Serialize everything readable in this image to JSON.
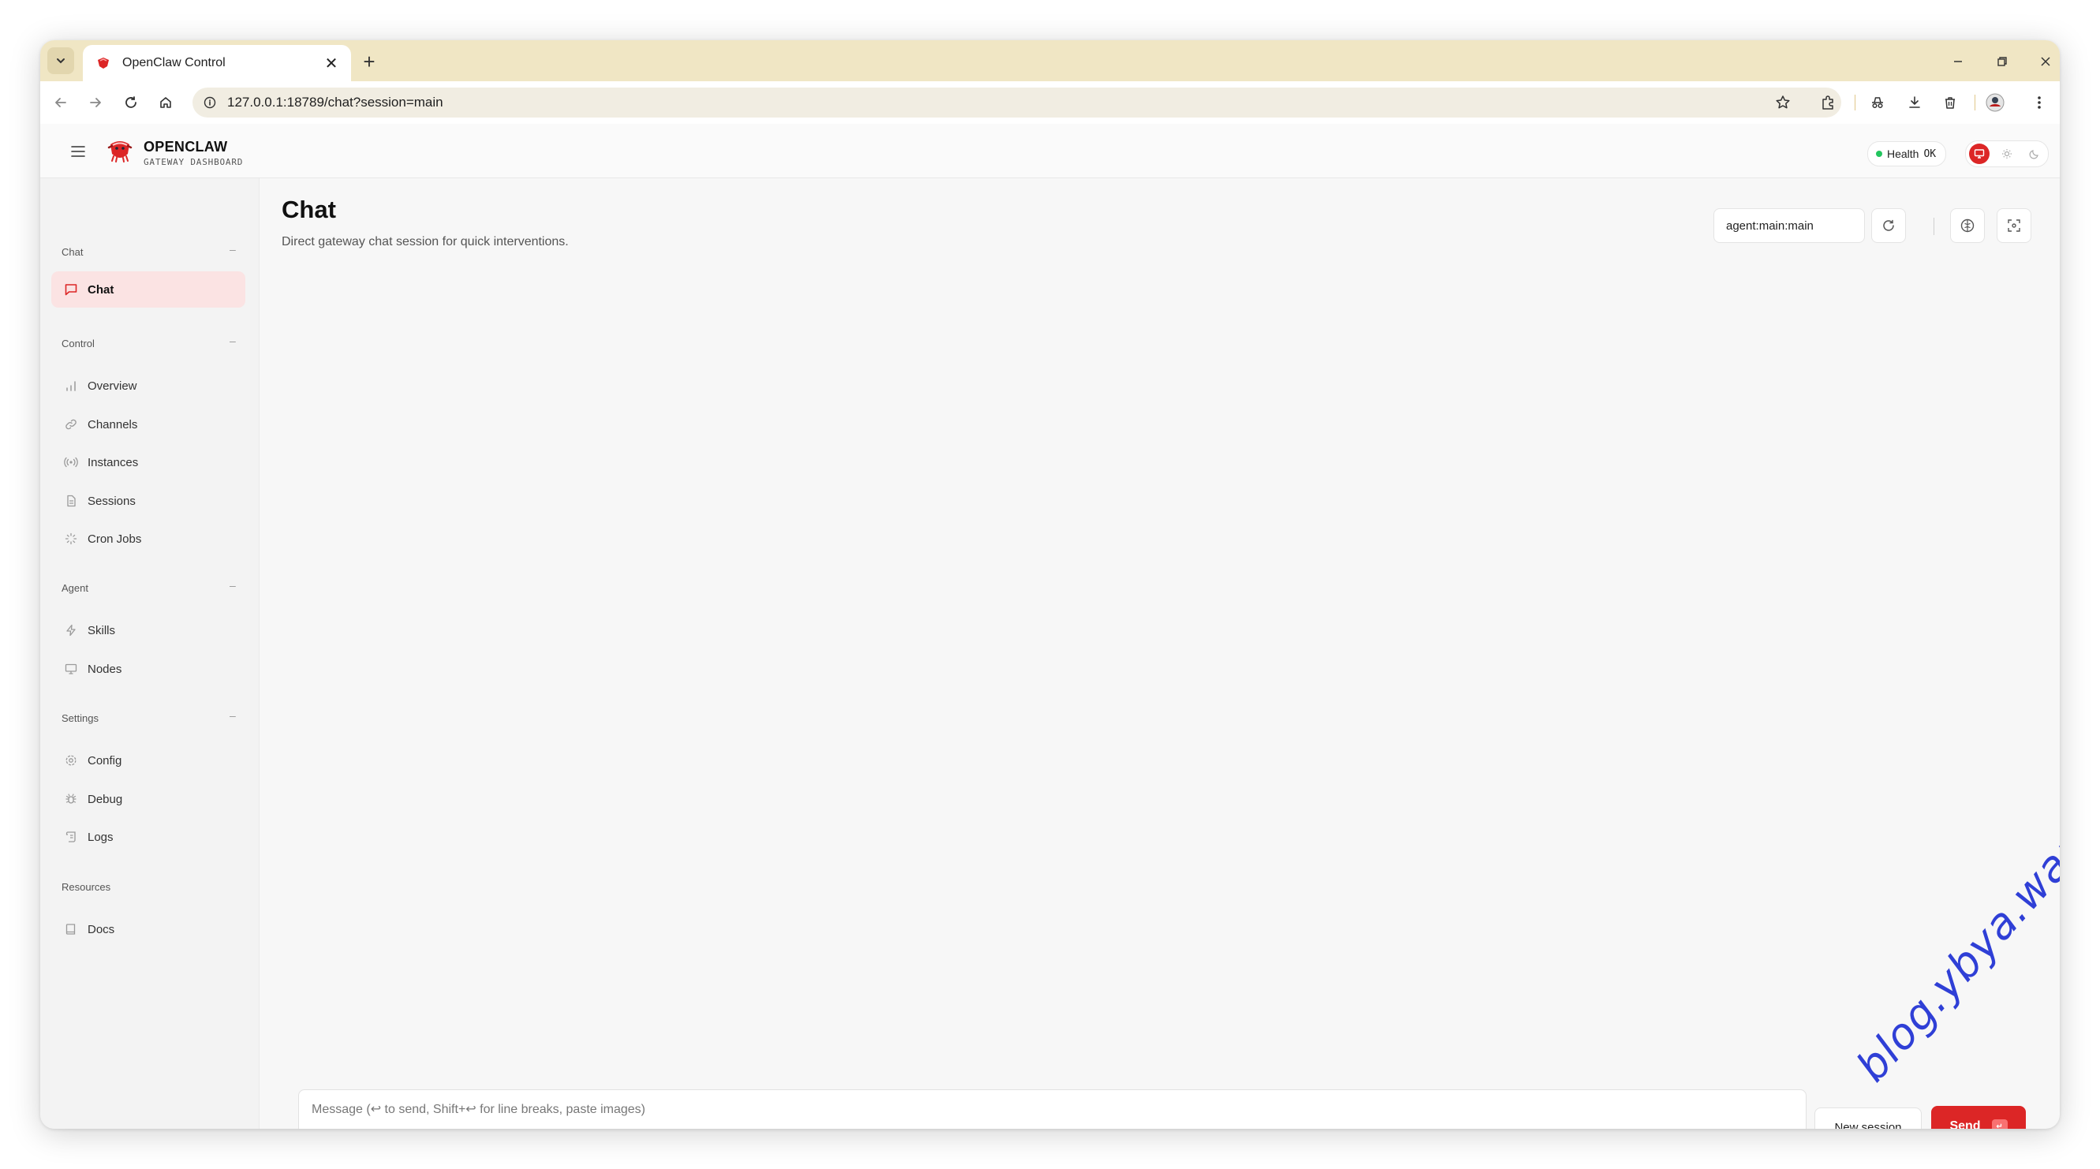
{
  "browser": {
    "tab_title": "OpenClaw Control",
    "url": "127.0.0.1:18789/chat?session=main"
  },
  "header": {
    "brand_name": "OPENCLAW",
    "brand_sub": "GATEWAY DASHBOARD",
    "health_label": "Health",
    "health_status": "OK"
  },
  "sidebar": {
    "sections": [
      {
        "label": "Chat",
        "items": [
          {
            "label": "Chat",
            "icon": "message-square-icon",
            "active": true
          }
        ]
      },
      {
        "label": "Control",
        "items": [
          {
            "label": "Overview",
            "icon": "bar-chart-icon"
          },
          {
            "label": "Channels",
            "icon": "link-icon"
          },
          {
            "label": "Instances",
            "icon": "radio-icon"
          },
          {
            "label": "Sessions",
            "icon": "file-text-icon"
          },
          {
            "label": "Cron Jobs",
            "icon": "loader-icon"
          }
        ]
      },
      {
        "label": "Agent",
        "items": [
          {
            "label": "Skills",
            "icon": "zap-icon"
          },
          {
            "label": "Nodes",
            "icon": "monitor-icon"
          }
        ]
      },
      {
        "label": "Settings",
        "items": [
          {
            "label": "Config",
            "icon": "settings-icon"
          },
          {
            "label": "Debug",
            "icon": "bug-icon"
          },
          {
            "label": "Logs",
            "icon": "scroll-icon"
          }
        ]
      },
      {
        "label": "Resources",
        "items": [
          {
            "label": "Docs",
            "icon": "book-icon"
          }
        ]
      }
    ]
  },
  "main": {
    "title": "Chat",
    "subtitle": "Direct gateway chat session for quick interventions.",
    "session": "agent:main:main",
    "composer_placeholder": "Message (↩ to send, Shift+↩ for line breaks, paste images)",
    "new_session_label": "New session",
    "send_label": "Send",
    "send_kbd": "↵"
  },
  "watermark": "blog.ybya.wang",
  "colors": {
    "accent": "#dc2626",
    "active_nav_bg": "#fbe3e3",
    "health_dot": "#22c55e",
    "tabbar_bg": "#f0e6c4"
  }
}
